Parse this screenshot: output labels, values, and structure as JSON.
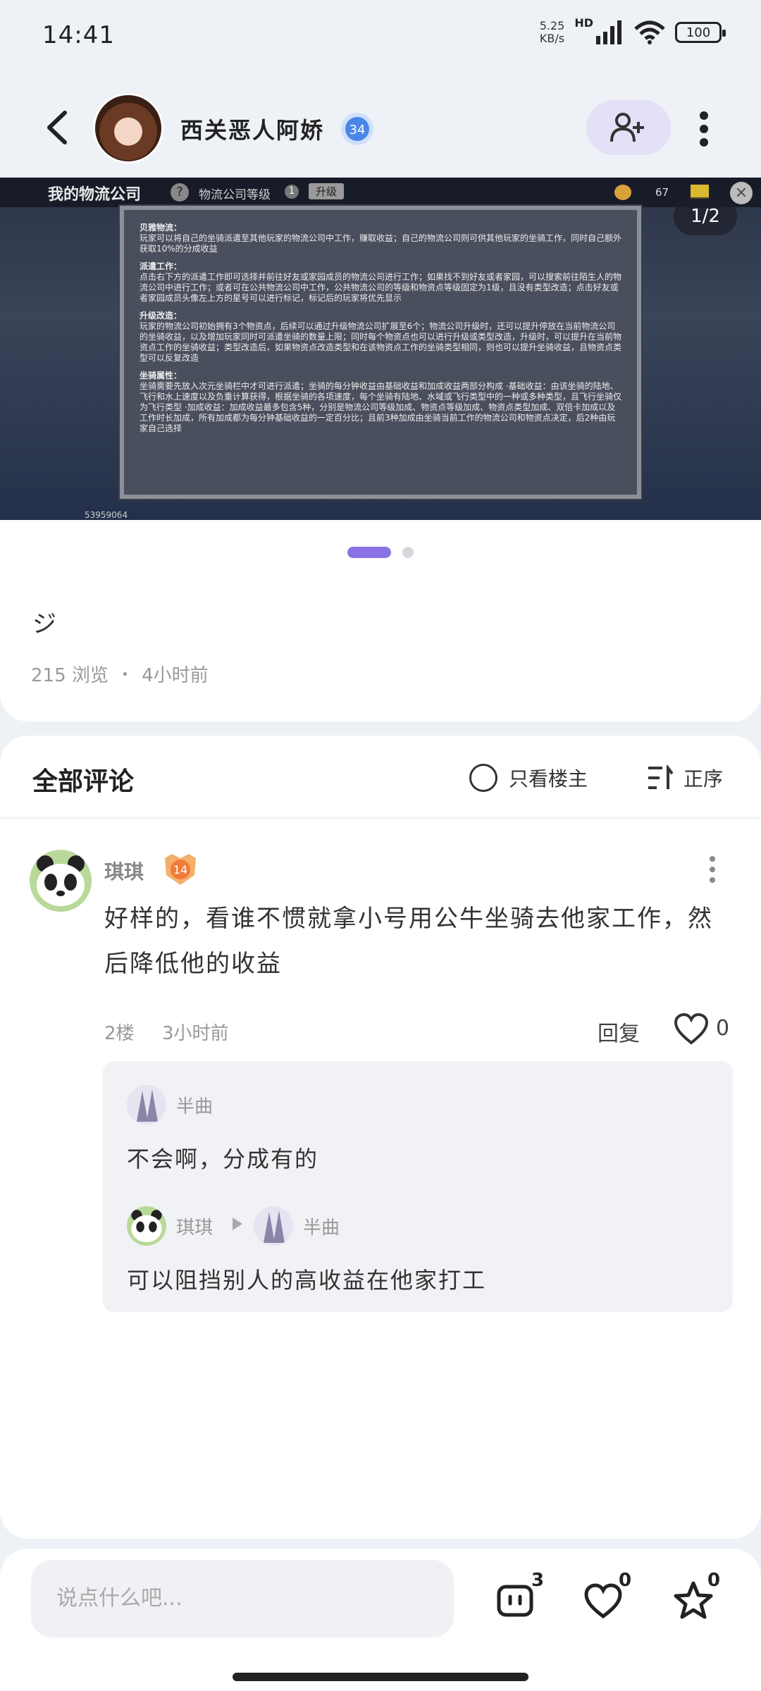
{
  "status": {
    "time": "14:41",
    "net_speed": "5.25",
    "net_unit": "KB/s",
    "hd": "HD",
    "battery": "100"
  },
  "header": {
    "username": "西关恶人阿娇",
    "level": "34"
  },
  "gallery": {
    "pager": "1/2",
    "game_title": "我的物流公司",
    "game_subtitle": "物流公司等级",
    "game_level": "1",
    "game_upgrade": "升级",
    "game_counter": "67",
    "game_id": "53959064",
    "panel": [
      {
        "title": "贝雅物流：",
        "text": "玩家可以将自己的坐骑派遣至其他玩家的物流公司中工作，赚取收益；自己的物流公司则可供其他玩家的坐骑工作，同时自己额外获取10%的分成收益"
      },
      {
        "title": "派遣工作：",
        "text": "点击右下方的派遣工作即可选择并前往好友或家园成员的物流公司进行工作；如果找不到好友或者家园，可以搜索前往陌生人的物流公司中进行工作；或者可在公共物流公司中工作，公共物流公司的等级和物资点等级固定为1级，且没有类型改造；点击好友或者家园成员头像左上方的星号可以进行标记，标记后的玩家将优先显示"
      },
      {
        "title": "升级改造：",
        "text": "玩家的物流公司初始拥有3个物资点，后续可以通过升级物流公司扩展至6个；物流公司升级时，还可以提升停放在当前物流公司的坐骑收益，以及增加玩家同时可派遣坐骑的数量上限；同时每个物资点也可以进行升级或类型改造，升级时，可以提升在当前物资点工作的坐骑收益；类型改造后，如果物资点改造类型和在该物资点工作的坐骑类型相同，则也可以提升坐骑收益，且物资点类型可以反复改造"
      },
      {
        "title": "坐骑属性：",
        "text": "坐骑需要先放入次元坐骑栏中才可进行派遣；坐骑的每分钟收益由基础收益和加成收益两部分构成 ·基础收益：由该坐骑的陆地、飞行和水上速度以及负重计算获得，根据坐骑的各项速度，每个坐骑有陆地、水域或飞行类型中的一种或多种类型，且飞行坐骑仅为飞行类型 ·加成收益：加成收益最多包含5种，分别是物流公司等级加成、物资点等级加成、物资点类型加成、双倍卡加成以及工作时长加成，所有加成都为每分钟基础收益的一定百分比；且前3种加成由坐骑当前工作的物流公司和物资点决定，后2种由玩家自己选择"
      }
    ]
  },
  "post": {
    "text": "ジ",
    "views": "215 浏览",
    "sep": "•",
    "time": "4小时前"
  },
  "comments": {
    "title": "全部评论",
    "only_owner": "只看楼主",
    "sort": "正序",
    "items": [
      {
        "name": "琪琪",
        "level": "14",
        "body": "好样的，看谁不惯就拿小号用公牛坐骑去他家工作，然后降低他的收益",
        "floor": "2楼",
        "time": "3小时前",
        "reply_label": "回复",
        "likes": "0",
        "replies": [
          {
            "name": "半曲",
            "text": "不会啊，分成有的"
          },
          {
            "name": "琪琪",
            "to": "半曲",
            "text": "可以阻挡别人的高收益在他家打工"
          }
        ]
      }
    ]
  },
  "bottom": {
    "placeholder": "说点什么吧...",
    "comment_count": "3",
    "like_count": "0",
    "fav_count": "0"
  },
  "colors": {
    "accent": "#8a72e6",
    "follow_bg": "#e4e0f7",
    "page_bg": "#eef1f6"
  }
}
